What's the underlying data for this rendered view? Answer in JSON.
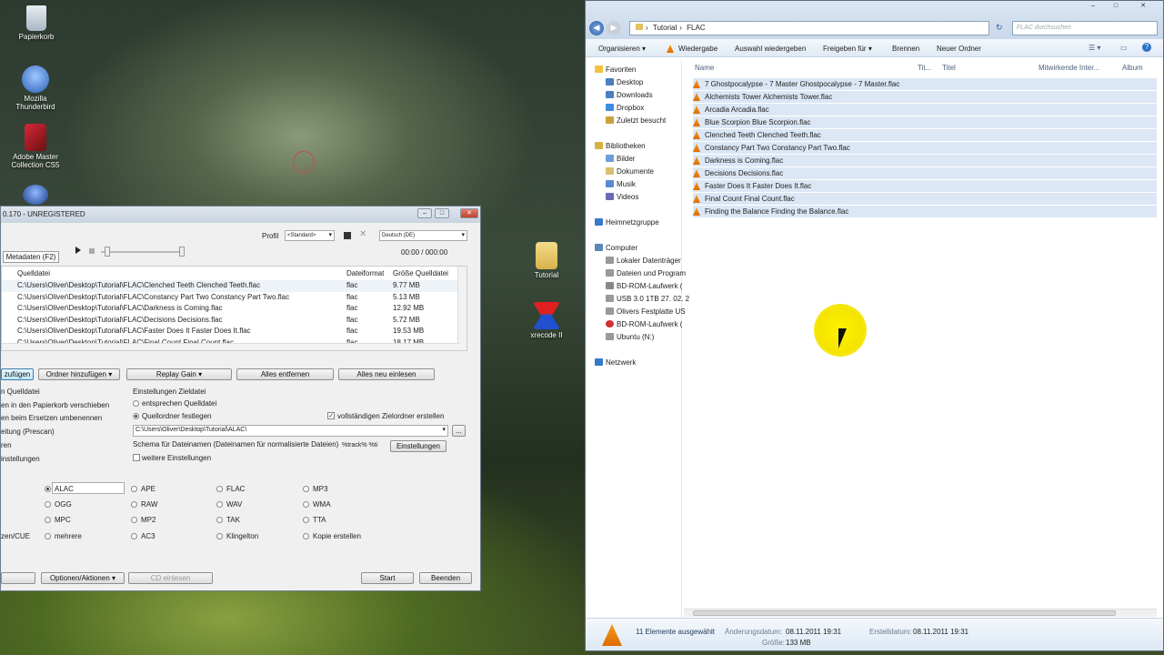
{
  "desktop": {
    "icons": [
      {
        "label": "Papierkorb"
      },
      {
        "label": "Mozilla Thunderbird"
      },
      {
        "label": "Adobe Master Collection CS5"
      },
      {
        "label": "Tutorial"
      },
      {
        "label": "xrecode II"
      }
    ]
  },
  "xrecode": {
    "title": "0.170 - UNREGISTERED",
    "profile_label": "Profil",
    "profile_value": "<Standard>",
    "language_value": "Deutsch (DE)",
    "metadata_tab": "Metadaten (F2)",
    "time": "00:00 / 000:00",
    "columns": [
      "Quelldatei",
      "Dateiformat",
      "Größe Quelldatei"
    ],
    "rows": [
      {
        "path": "C:\\Users\\Oliver\\Desktop\\Tutorial\\FLAC\\Clenched Teeth Clenched Teeth.flac",
        "fmt": "flac",
        "size": "9.77 MB"
      },
      {
        "path": "C:\\Users\\Oliver\\Desktop\\Tutorial\\FLAC\\Constancy Part Two Constancy Part Two.flac",
        "fmt": "flac",
        "size": "5.13 MB"
      },
      {
        "path": "C:\\Users\\Oliver\\Desktop\\Tutorial\\FLAC\\Darkness is Coming.flac",
        "fmt": "flac",
        "size": "12.92 MB"
      },
      {
        "path": "C:\\Users\\Oliver\\Desktop\\Tutorial\\FLAC\\Decisions Decisions.flac",
        "fmt": "flac",
        "size": "5.72 MB"
      },
      {
        "path": "C:\\Users\\Oliver\\Desktop\\Tutorial\\FLAC\\Faster Does It Faster Does It.flac",
        "fmt": "flac",
        "size": "19.53 MB"
      },
      {
        "path": "C:\\Users\\Oliver\\Desktop\\Tutorial\\FLAC\\Final Count Final Count.flac",
        "fmt": "flac",
        "size": "18.17 MB"
      }
    ],
    "buttons": {
      "add_files": "zufügen",
      "add_folder": "Ordner hinzufügen",
      "replay_gain": "Replay Gain",
      "remove_all": "Alles entfernen",
      "reload": "Alles neu einlesen"
    },
    "left_opts": [
      "n Quelldatei",
      "en in den Papierkorb verschieben",
      "en beim Ersetzen umbenennen",
      "eitung (Prescan)",
      "ren",
      "instellungen"
    ],
    "dest": {
      "header": "Einstellungen Zieldatei",
      "opt_source": "entsprechen Quelldatei",
      "opt_folder": "Quellordner festlegen",
      "full_folder": "vollständigen Zielordner erstellen",
      "path": "C:\\Users\\Oliver\\Desktop\\Tutorial\\ALAC\\",
      "browse": "...",
      "schema_label": "Schema für Dateinamen (Dateinamen für normalisierte Dateien)",
      "schema_value": "%track% %ti",
      "settings_btn": "Einstellungen",
      "more": "weitere Einstellungen"
    },
    "formats": [
      [
        "ALAC",
        "APE",
        "FLAC",
        "MP3"
      ],
      [
        "OGG",
        "RAW",
        "WAV",
        "WMA"
      ],
      [
        "MPC",
        "MP2",
        "TAK",
        "TTA"
      ],
      [
        "mehrere",
        "AC3",
        "Klingelton",
        "Kopie erstellen"
      ]
    ],
    "zen_cue": "zen/CUE",
    "bottom": {
      "options": "Optionen/Aktionen",
      "cd": "CD einlesen",
      "start": "Start",
      "quit": "Beenden"
    }
  },
  "explorer": {
    "breadcrumb": [
      "Tutorial",
      "FLAC"
    ],
    "search_placeholder": "FLAC durchsuchen",
    "toolbar": [
      "Organisieren",
      "Wiedergabe",
      "Auswahl wiedergeben",
      "Freigeben für",
      "Brennen",
      "Neuer Ordner"
    ],
    "columns": [
      "Name",
      "Tit...",
      "Titel",
      "Mitwirkende Inter...",
      "Album"
    ],
    "tree": [
      {
        "label": "Favoriten",
        "lvl": 0,
        "c": "#f2c23a"
      },
      {
        "label": "Desktop",
        "lvl": 1,
        "c": "#4a7fc0"
      },
      {
        "label": "Downloads",
        "lvl": 1,
        "c": "#4a7fc0"
      },
      {
        "label": "Dropbox",
        "lvl": 1,
        "c": "#3b8de0"
      },
      {
        "label": "Zuletzt besucht",
        "lvl": 1,
        "c": "#c8a040"
      },
      {
        "label": "Bibliotheken",
        "lvl": 0,
        "c": "#d9b040"
      },
      {
        "label": "Bilder",
        "lvl": 1,
        "c": "#6aa0d8"
      },
      {
        "label": "Dokumente",
        "lvl": 1,
        "c": "#d9c070"
      },
      {
        "label": "Musik",
        "lvl": 1,
        "c": "#5a8ad0"
      },
      {
        "label": "Videos",
        "lvl": 1,
        "c": "#6a6ab8"
      },
      {
        "label": "Heimnetzgruppe",
        "lvl": 0,
        "c": "#3a78c8"
      },
      {
        "label": "Computer",
        "lvl": 0,
        "c": "#5a86b8"
      },
      {
        "label": "Lokaler Datenträger",
        "lvl": 1,
        "c": "#999"
      },
      {
        "label": "Dateien und Program",
        "lvl": 1,
        "c": "#999"
      },
      {
        "label": "BD-ROM-Laufwerk (",
        "lvl": 1,
        "c": "#888"
      },
      {
        "label": "USB 3.0 1TB 27. 02. 2",
        "lvl": 1,
        "c": "#999"
      },
      {
        "label": "Olivers Festplatte US",
        "lvl": 1,
        "c": "#999"
      },
      {
        "label": "BD-ROM-Laufwerk (",
        "lvl": 1,
        "c": "#d03030"
      },
      {
        "label": "Ubuntu (N:)",
        "lvl": 1,
        "c": "#999"
      },
      {
        "label": "Netzwerk",
        "lvl": 0,
        "c": "#3a78c8"
      }
    ],
    "files": [
      "7  Ghostpocalypse - 7 Master Ghostpocalypse - 7 Master.flac",
      "Alchemists Tower Alchemists Tower.flac",
      "Arcadia Arcadia.flac",
      "Blue Scorpion Blue Scorpion.flac",
      "Clenched Teeth Clenched Teeth.flac",
      "Constancy Part Two Constancy Part Two.flac",
      "Darkness is Coming.flac",
      "Decisions Decisions.flac",
      "Faster Does It Faster Does It.flac",
      "Final Count Final Count.flac",
      "Finding the Balance Finding the Balance.flac"
    ],
    "status": {
      "selected": "11 Elemente ausgewählt",
      "mod_label": "Änderungsdatum:",
      "mod_value": "08.11.2011 19:31",
      "created_label": "Erstelldatum:",
      "created_value": "08.11.2011 19:31",
      "size_label": "Größe:",
      "size_value": "133 MB"
    }
  }
}
